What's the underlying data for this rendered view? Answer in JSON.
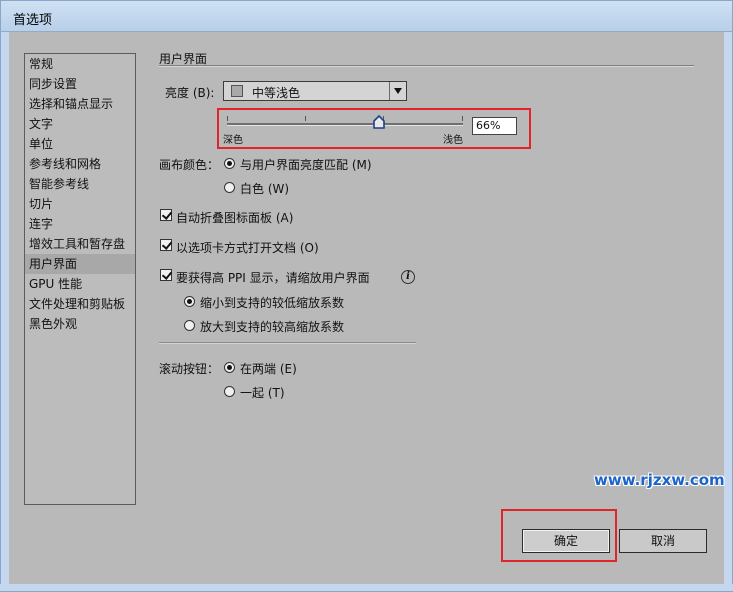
{
  "window": {
    "title": "首选项"
  },
  "sidebar": {
    "items": [
      "常规",
      "同步设置",
      "选择和锚点显示",
      "文字",
      "单位",
      "参考线和网格",
      "智能参考线",
      "切片",
      "连字",
      "增效工具和暂存盘",
      "用户界面",
      "GPU 性能",
      "文件处理和剪贴板",
      "黑色外观"
    ],
    "selected_index": 10
  },
  "main": {
    "section_title": "用户界面",
    "brightness": {
      "label": "亮度 (B):",
      "selected": "中等浅色",
      "slider_dark_label": "深色",
      "slider_light_label": "浅色",
      "slider_value": "66%"
    },
    "canvas_color": {
      "label": "画布颜色：",
      "options": [
        "与用户界面亮度匹配 (M)",
        "白色 (W)"
      ],
      "selected_index": 0
    },
    "checkboxes": [
      {
        "label": "自动折叠图标面板 (A)",
        "checked": true
      },
      {
        "label": "以选项卡方式打开文档 (O)",
        "checked": true
      },
      {
        "label": "要获得高 PPI 显示，请缩放用户界面",
        "checked": true
      }
    ],
    "ppi_options": {
      "options": [
        "缩小到支持的较低缩放系数",
        "放大到支持的较高缩放系数"
      ],
      "selected_index": 0
    },
    "scroll_buttons": {
      "label": "滚动按钮：",
      "options": [
        "在两端 (E)",
        "一起 (T)"
      ],
      "selected_index": 0
    }
  },
  "watermark": "www.rjzxw.com",
  "buttons": {
    "ok": "确定",
    "cancel": "取消"
  },
  "colors": {
    "highlight_red": "#e0242a",
    "watermark_blue": "#1b64c8"
  }
}
